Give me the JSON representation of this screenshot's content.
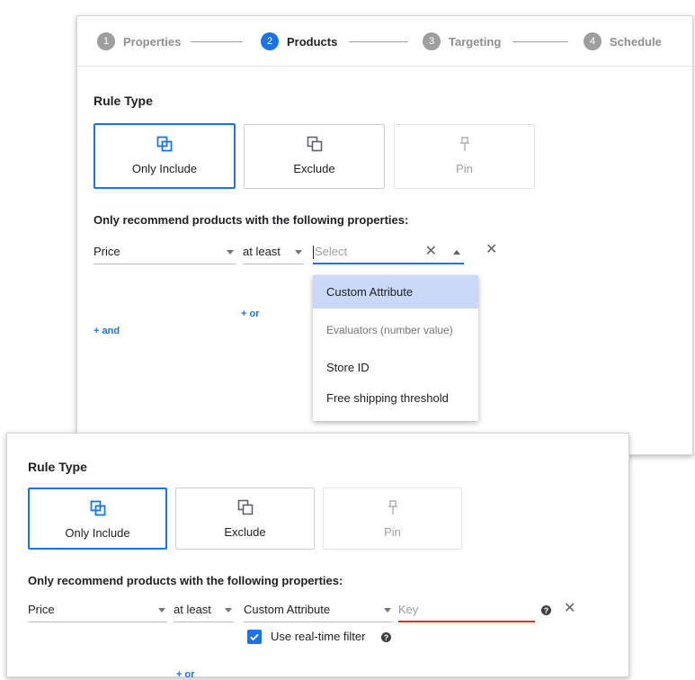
{
  "stepper": {
    "steps": [
      {
        "num": "1",
        "label": "Properties",
        "state": "inactive"
      },
      {
        "num": "2",
        "label": "Products",
        "state": "active"
      },
      {
        "num": "3",
        "label": "Targeting",
        "state": "inactive"
      },
      {
        "num": "4",
        "label": "Schedule",
        "state": "inactive"
      }
    ]
  },
  "back": {
    "rule_type_title": "Rule Type",
    "options": [
      "Only Include",
      "Exclude",
      "Pin"
    ],
    "selected_option": "Only Include",
    "properties_title": "Only recommend products with the following properties:",
    "attribute_value": "Price",
    "operator_value": "at least",
    "value_placeholder": "Select",
    "and_link": "+ and",
    "or_link": "+ or",
    "dropdown": {
      "highlighted": "Custom Attribute",
      "group_label": "Evaluators (number value)",
      "items": [
        "Store ID",
        "Free shipping threshold"
      ]
    }
  },
  "front": {
    "rule_type_title": "Rule Type",
    "options": [
      "Only Include",
      "Exclude",
      "Pin"
    ],
    "selected_option": "Only Include",
    "properties_title": "Only recommend products with the following properties:",
    "attribute_value": "Price",
    "operator_value": "at least",
    "value_value": "Custom Attribute",
    "key_placeholder": "Key",
    "realtime_label": "Use real-time filter",
    "realtime_checked": true,
    "or_link": "+ or"
  },
  "colors": {
    "accent": "#1a73e8",
    "error": "#d93025",
    "highlight": "#c9d9f7"
  }
}
